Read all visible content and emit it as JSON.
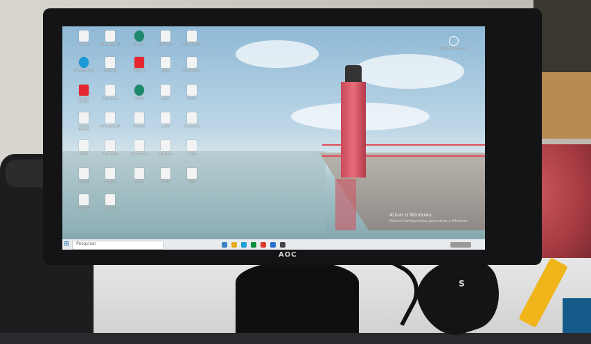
{
  "photo": {
    "monitor_brand": "AOC",
    "mouse_mark": "S"
  },
  "desktop": {
    "icons": [
      {
        "label": "Lixeira",
        "type": "file"
      },
      {
        "label": "Novo pasta (3)",
        "type": "file"
      },
      {
        "label": "Governo",
        "type": "green"
      },
      {
        "label": "SERVIÇOS",
        "type": "file"
      },
      {
        "label": "FOTO EDITAR",
        "type": "file"
      },
      {
        "label": "Microsoft Edge",
        "type": "edge"
      },
      {
        "label": "WhatsApp",
        "type": "file"
      },
      {
        "label": "PROJETO",
        "type": "pdf"
      },
      {
        "label": "pasta",
        "type": "file"
      },
      {
        "label": "Documentos",
        "type": "file"
      },
      {
        "label": "Acrobat Reader",
        "type": "pdf"
      },
      {
        "label": "Nova pasta",
        "type": "file"
      },
      {
        "label": "Torrent",
        "type": "green"
      },
      {
        "label": "pasta",
        "type": "file"
      },
      {
        "label": "Arquivo",
        "type": "file"
      },
      {
        "label": "Google Chrome",
        "type": "file"
      },
      {
        "label": "Nova pasta (2)",
        "type": "file"
      },
      {
        "label": "Arquivos",
        "type": "file"
      },
      {
        "label": "pasta",
        "type": "file"
      },
      {
        "label": "Documento",
        "type": "file"
      },
      {
        "label": "Bloco",
        "type": "file"
      },
      {
        "label": "Nova pasta",
        "type": "file"
      },
      {
        "label": "Nova pasta",
        "type": "file"
      },
      {
        "label": "Imagem",
        "type": "file"
      },
      {
        "label": "Fotos",
        "type": "file"
      },
      {
        "label": "Arquivo",
        "type": "file"
      },
      {
        "label": "Imagens",
        "type": "file"
      },
      {
        "label": "pasta",
        "type": "file"
      },
      {
        "label": "Atalho",
        "type": "file"
      },
      {
        "label": "Pasta",
        "type": "file"
      },
      {
        "label": "Arquivo",
        "type": "file"
      },
      {
        "label": "Programa",
        "type": "file"
      }
    ],
    "widget_label": "Cuide mais da saúde"
  },
  "taskbar": {
    "start_glyph": "⊞",
    "search_placeholder": "Pesquisar"
  },
  "activation": {
    "title": "Ativar o Windows",
    "subtitle": "Acesse Configurações para ativar o Windows."
  }
}
